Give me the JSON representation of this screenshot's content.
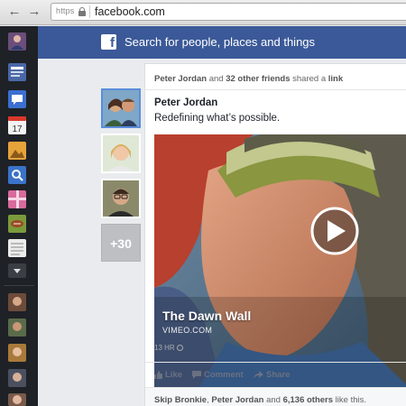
{
  "browser": {
    "protocol": "https",
    "url": "facebook.com"
  },
  "fbbar": {
    "logo": "f",
    "search_placeholder": "Search for people, places and things"
  },
  "story": {
    "header_actor": "Peter Jordan",
    "header_and": " and ",
    "header_friends": "32 other friends",
    "header_shared": " shared a ",
    "header_link": "link",
    "author": "Peter Jordan",
    "status": "Redefining what’s possible.",
    "video_title": "The Dawn Wall",
    "video_source": "VIMEO.COM",
    "timestamp": "13 HR",
    "actions": {
      "like": "Like",
      "comment": "Comment",
      "share": "Share"
    },
    "likes_name1": "Skip Bronkie",
    "likes_sep": ", ",
    "likes_name2": "Peter Jordan",
    "likes_and": " and ",
    "likes_count": "6,136 others",
    "likes_suffix": " like this."
  },
  "friends": {
    "more_label": "+30"
  },
  "dock_icons": [
    "profile-icon",
    "news-feed-icon",
    "messages-icon",
    "events-icon",
    "photos-icon",
    "search-icon",
    "gifts-icon",
    "games-icon",
    "notes-icon",
    "more-icon"
  ],
  "colors": {
    "facebook_blue": "#3b5998",
    "dock_bg": "#1e2126",
    "selected_border": "#5b8ddb"
  }
}
